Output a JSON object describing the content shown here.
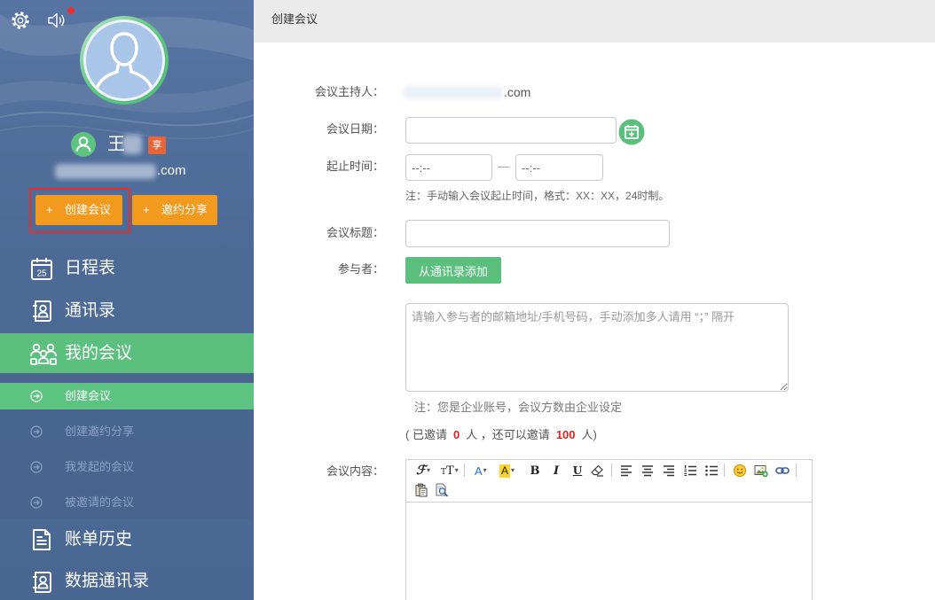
{
  "colors": {
    "sidebar": "#4d6a97",
    "green": "#5bbf7e",
    "orange": "#f29a1e",
    "highlight_box": "#e0332f",
    "badge": "#e8653a",
    "count_red": "#e02020",
    "notice_dot": "#e53030"
  },
  "sidebar": {
    "top_icons": {
      "settings": "gear-icon",
      "sound": "speaker-icon"
    },
    "avatar_icon": "default-avatar-icon",
    "user": {
      "icon": "user-icon",
      "name": "王",
      "badge": "享",
      "email_suffix": ".com"
    },
    "actions": [
      {
        "symbol": "+",
        "label": "创建会议",
        "highlighted": true
      },
      {
        "symbol": "+",
        "label": "邀约分享"
      }
    ],
    "nav": [
      {
        "label": "日程表",
        "icon": "calendar-icon",
        "calendar_day": "25"
      },
      {
        "label": "通讯录",
        "icon": "contacts-icon"
      },
      {
        "label": "我的会议",
        "icon": "meeting-icon",
        "active": true,
        "children": [
          {
            "label": "创建会议",
            "icon": "arrow-circle-icon",
            "active": true
          },
          {
            "label": "创建邀约分享",
            "icon": "arrow-circle-icon"
          },
          {
            "label": "我发起的会议",
            "icon": "arrow-circle-icon"
          },
          {
            "label": "被邀请的会议",
            "icon": "arrow-circle-icon"
          }
        ]
      },
      {
        "label": "账单历史",
        "icon": "bill-icon"
      },
      {
        "label": "数据通讯录",
        "icon": "contacts-icon"
      }
    ]
  },
  "header": {
    "title": "创建会议"
  },
  "form": {
    "host": {
      "label": "会议主持人：",
      "value_suffix": ".com"
    },
    "date": {
      "label": "会议日期：",
      "value": "",
      "picker_icon": "calendar-add-icon"
    },
    "time": {
      "label": "起止时间：",
      "start_placeholder": "--:--",
      "end_placeholder": "--:--",
      "separator": "—",
      "note": "注：手动输入会议起止时间，格式：XX：XX，24时制。"
    },
    "subject": {
      "label": "会议标题：",
      "value": ""
    },
    "participants": {
      "label": "参与者：",
      "add_button": "从通讯录添加",
      "placeholder": "请输入参与者的邮箱地址/手机号码，手动添加多人请用 “；” 隔开",
      "value": "",
      "note": "注：您是企业账号，会议方数由企业设定",
      "invite_status": {
        "prefix": "( 已邀请",
        "invited": "0",
        "middle": "人 ，还可以邀请",
        "remaining": "100",
        "suffix": "人)"
      }
    },
    "content": {
      "label": "会议内容：",
      "value": "",
      "toolbar": {
        "font_family": {
          "glyph": "ℱ",
          "caret": "▾"
        },
        "font_size": {
          "glyph_small": "T",
          "glyph_large": "T",
          "caret": "▾"
        },
        "font_color": {
          "glyph": "A",
          "caret": "▾"
        },
        "highlight": {
          "glyph": "A",
          "caret": "▾"
        },
        "bold": "B",
        "italic": "I",
        "underline": "U",
        "icons": [
          "eraser-icon",
          "align-left-icon",
          "align-center-icon",
          "align-right-icon",
          "ordered-list-icon",
          "unordered-list-icon",
          "emoji-icon",
          "insert-image-icon",
          "link-icon",
          "paste-icon",
          "preview-icon"
        ]
      }
    }
  }
}
